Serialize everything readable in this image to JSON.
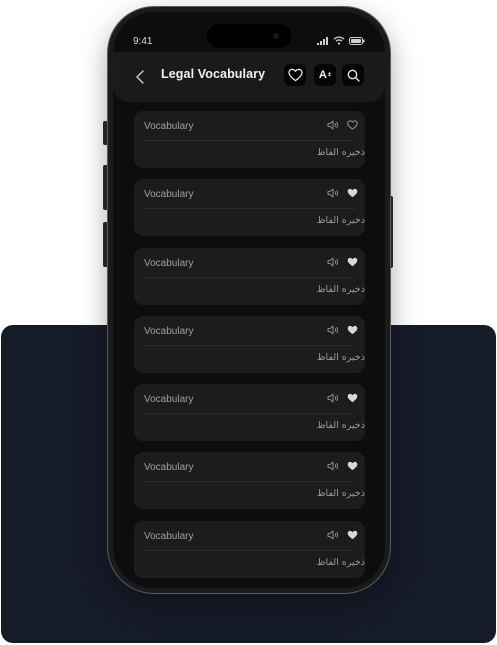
{
  "status_bar": {
    "time": "9:41"
  },
  "header": {
    "title": "Legal Vocabulary",
    "font_button_label": "A",
    "font_button_sup": "±"
  },
  "colors": {
    "backdrop": "#161b28",
    "screen_bg": "#0d0d0e",
    "card_bg": "#1c1c1e",
    "heart_filled": "#d8d8d8"
  },
  "icons": {
    "back": "chevron-left-icon",
    "favorite": "heart-outline-icon",
    "search": "search-icon",
    "speaker": "speaker-icon",
    "heart_outline": "heart-outline-icon",
    "heart_filled": "heart-filled-icon"
  },
  "cards": [
    {
      "title": "Vocabulary",
      "translation": "ذخیره الفاظ",
      "favorited": false
    },
    {
      "title": "Vocabulary",
      "translation": "ذخیره الفاظ",
      "favorited": true
    },
    {
      "title": "Vocabulary",
      "translation": "ذخیره الفاظ",
      "favorited": true
    },
    {
      "title": "Vocabulary",
      "translation": "ذخیره الفاظ",
      "favorited": true
    },
    {
      "title": "Vocabulary",
      "translation": "ذخیره الفاظ",
      "favorited": true
    },
    {
      "title": "Vocabulary",
      "translation": "ذخیره الفاظ",
      "favorited": true
    },
    {
      "title": "Vocabulary",
      "translation": "ذخیره الفاظ",
      "favorited": true
    }
  ]
}
